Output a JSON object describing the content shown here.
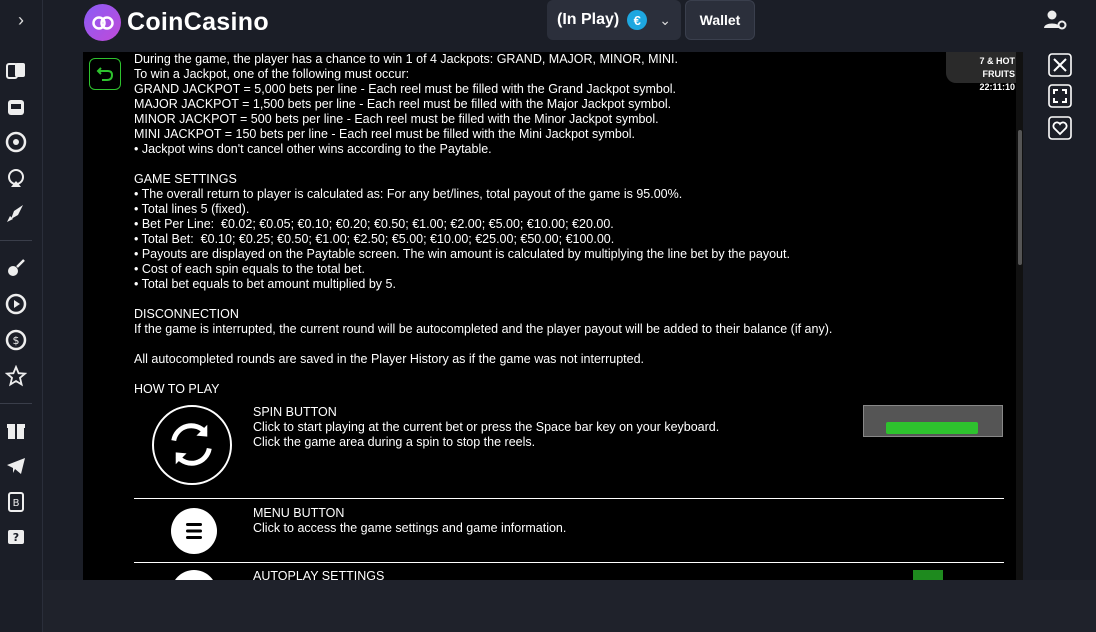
{
  "app": {
    "brand": "CoinCasino"
  },
  "header": {
    "inplay_label": "(In Play)",
    "currency_symbol": "€",
    "wallet_label": "Wallet"
  },
  "game_badge": {
    "title": "7 & HOT FRUITS",
    "time": "22:11:10"
  },
  "info": {
    "jackpot_lines": [
      "During the game, the player has a chance to win 1 of 4 Jackpots: GRAND, MAJOR, MINOR, MINI.",
      "To win a Jackpot, one of the following must occur:",
      "GRAND JACKPOT = 5,000 bets per line - Each reel must be filled with the Grand Jackpot symbol.",
      "MAJOR JACKPOT = 1,500 bets per line - Each reel must be filled with the Major Jackpot symbol.",
      "MINOR JACKPOT = 500 bets per line - Each reel must be filled with the Minor Jackpot symbol.",
      "MINI JACKPOT = 150 bets per line - Each reel must be filled with the Mini Jackpot symbol.",
      "• Jackpot wins don't cancel other wins according to the Paytable."
    ],
    "settings_title": "GAME SETTINGS",
    "settings_lines": [
      "• The overall return to player is calculated as: For any bet/lines, total payout of the game is 95.00%.",
      "• Total lines 5 (fixed).",
      "• Bet Per Line:  €0.02; €0.05; €0.10; €0.20; €0.50; €1.00; €2.00; €5.00; €10.00; €20.00.",
      "• Total Bet:  €0.10; €0.25; €0.50; €1.00; €2.50; €5.00; €10.00; €25.00; €50.00; €100.00.",
      "• Payouts are displayed on the Paytable screen. The win amount is calculated by multiplying the line bet by the payout.",
      "• Cost of each spin equals to the total bet.",
      "• Total bet equals to bet amount multiplied by 5."
    ],
    "disconnection_title": "DISCONNECTION",
    "disconnection_lines": [
      "If the game is interrupted, the current round will be autocompleted and the player payout will be added to their balance (if any).",
      "",
      "All autocompleted rounds are saved in the Player History as if the game was not interrupted."
    ],
    "howto_title": "HOW TO PLAY",
    "spin_title": "SPIN BUTTON",
    "spin_line1": "Click to start playing at the current bet or press the Space bar key on your keyboard.",
    "spin_line2": "Click the game area during a spin to stop the reels.",
    "menu_title": "MENU BUTTON",
    "menu_line1": "Click to access the game settings and game information.",
    "autoplay_title": "AUTOPLAY SETTINGS"
  }
}
